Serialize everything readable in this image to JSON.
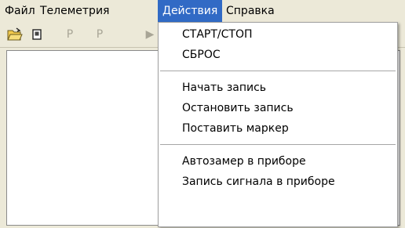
{
  "menubar": {
    "items": [
      "Файл",
      "Телеметрия",
      "Действия",
      "Справка"
    ]
  },
  "toolbar": {
    "buttons": [
      {
        "icon": "open-folder-icon",
        "label": ""
      },
      {
        "icon": "device-icon",
        "label": ""
      },
      {
        "icon": "p-icon",
        "label": "P"
      },
      {
        "icon": "p-icon",
        "label": "P"
      },
      {
        "icon": "play-icon",
        "label": "▶"
      }
    ]
  },
  "dropdown": {
    "groups": [
      [
        "СТАРТ/СТОП",
        "СБРОС"
      ],
      [
        "Начать запись",
        "Остановить запись",
        "Поставить маркер"
      ],
      [
        "Автозамер в приборе",
        "Запись сигнала в приборе"
      ]
    ]
  },
  "colors": {
    "menu_highlight": "#316ac5",
    "face": "#ece9d8",
    "disabled": "#a8a596"
  }
}
